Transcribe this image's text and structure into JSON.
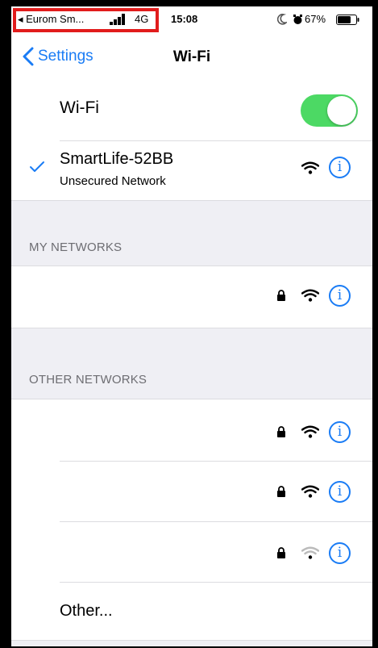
{
  "status_bar": {
    "carrier": "◂ Eurom Sm...",
    "network": "4G",
    "time": "15:08",
    "battery": "67%"
  },
  "nav": {
    "back_label": "Settings",
    "title": "Wi-Fi"
  },
  "wifi_toggle": {
    "label": "Wi-Fi",
    "on": true,
    "color": "#4cd964"
  },
  "connected": {
    "name": "SmartLife-52BB",
    "subtitle": "Unsecured Network"
  },
  "my_networks": {
    "header": "MY NETWORKS"
  },
  "other_networks": {
    "header": "OTHER NETWORKS",
    "other_label": "Other..."
  },
  "colors": {
    "accent": "#1a7cf5",
    "highlight": "#e11c1c"
  }
}
